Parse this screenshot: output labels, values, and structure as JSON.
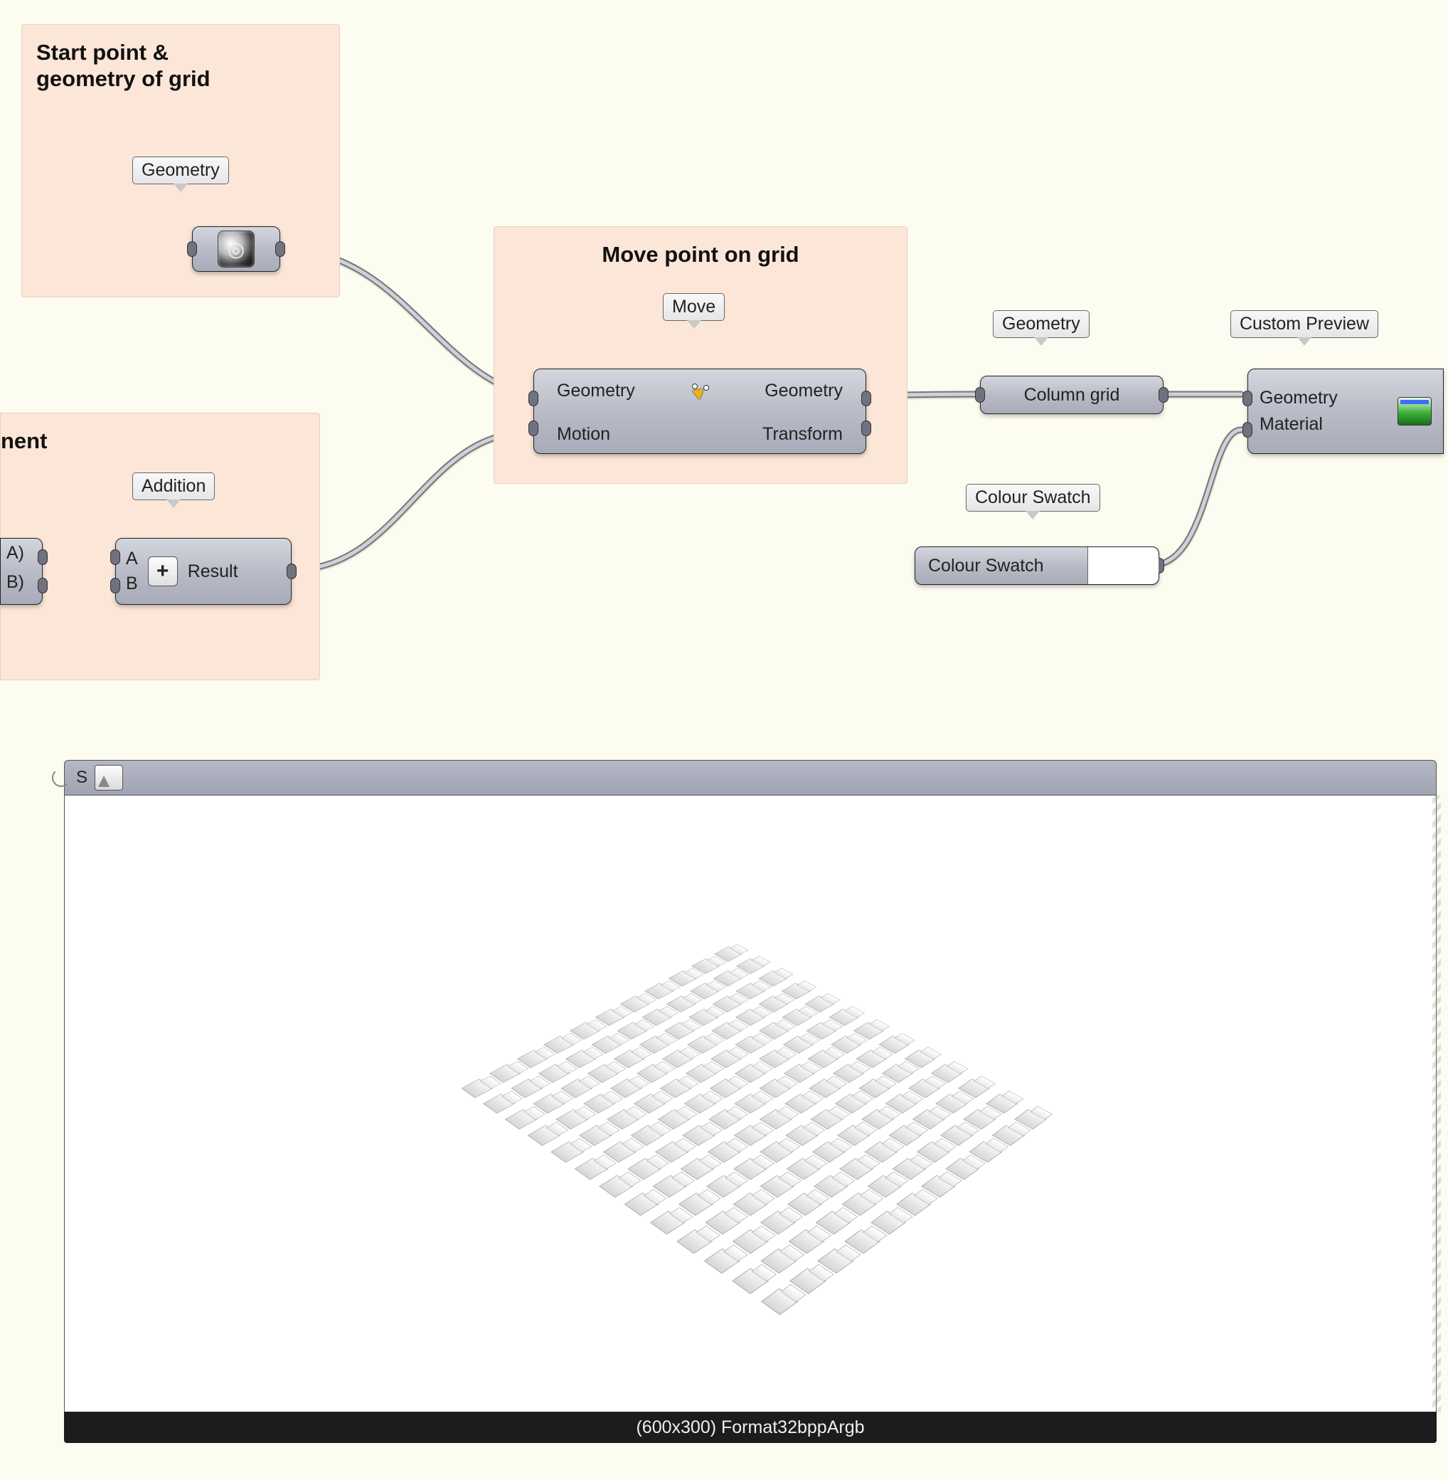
{
  "groups": {
    "grid": {
      "title_l1": "Start point &",
      "title_l2": "geometry of grid"
    },
    "move": {
      "title": "Move point on grid"
    },
    "addition_frag": "nent"
  },
  "tags": {
    "geometry_top": "Geometry",
    "move": "Move",
    "addition": "Addition",
    "geometry_mid_param": "Geometry",
    "colour_swatch_tag": "Colour Swatch",
    "custom_preview": "Custom Preview"
  },
  "nodes": {
    "move": {
      "in_geometry": "Geometry",
      "in_motion": "Motion",
      "out_geometry": "Geometry",
      "out_transform": "Transform"
    },
    "addition": {
      "in_a": "A",
      "in_b": "B",
      "out": "Result",
      "in_a_frag": "A)",
      "in_b_frag": "B)"
    },
    "column_grid": "Column grid",
    "colour_swatch": "Colour Swatch",
    "preview": {
      "in_geometry": "Geometry",
      "in_material": "Material"
    }
  },
  "viewport": {
    "s_label": "S",
    "footer": "(600x300) Format32bppArgb"
  }
}
